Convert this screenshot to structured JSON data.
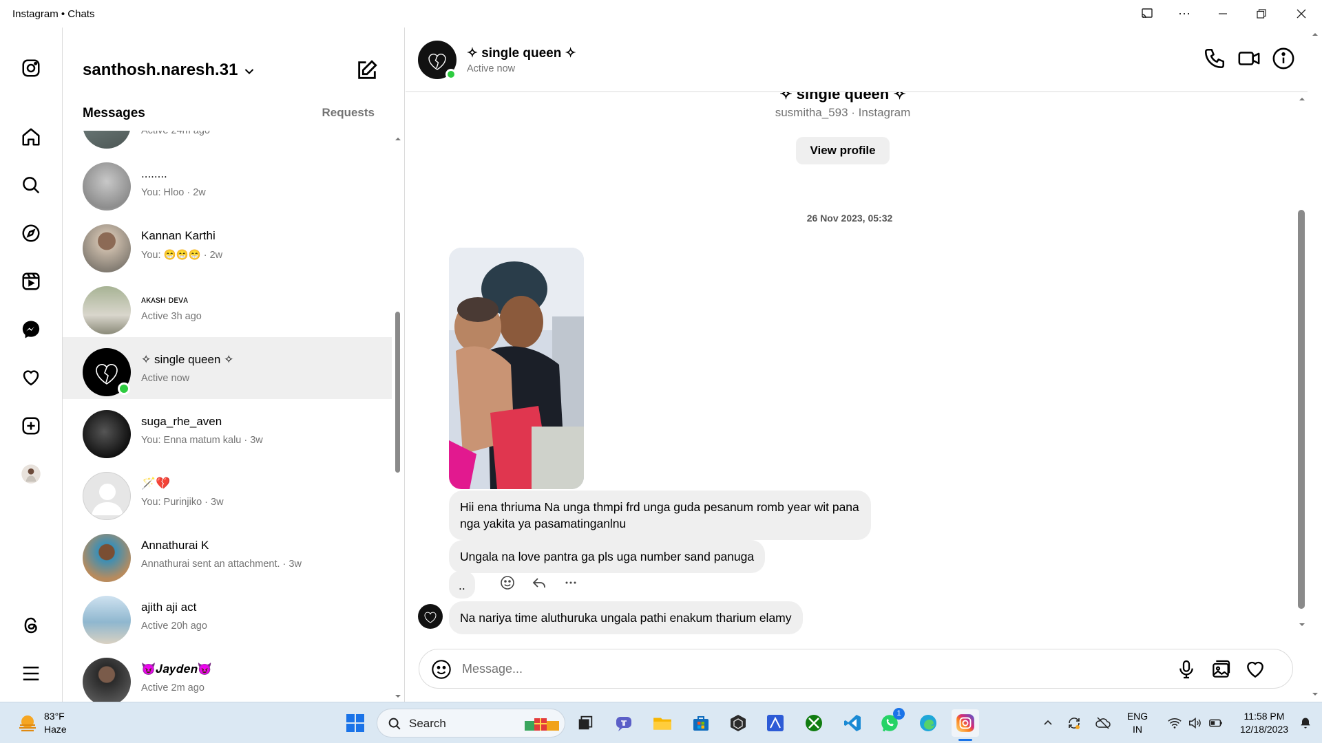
{
  "window": {
    "title": "Instagram • Chats"
  },
  "sidebar": {
    "profile_username": "santhosh.naresh.31"
  },
  "inbox": {
    "messages_label": "Messages",
    "requests_label": "Requests",
    "threads": [
      {
        "name": "",
        "sub": "Active 24m ago"
      },
      {
        "name": "........",
        "sub": "You: Hloo · 2w"
      },
      {
        "name": "Kannan Karthi",
        "sub": "You: 😁😁😁 · 2w"
      },
      {
        "name": "ᴀᴋᴀsʜ ᴅᴇᴠᴀ",
        "sub": "Active 3h ago"
      },
      {
        "name": "✧ single queen ✧",
        "sub": "Active now"
      },
      {
        "name": "suga_rhe_aven",
        "sub": "You: Enna matum kalu · 3w"
      },
      {
        "name": "🪄💔",
        "sub": "You: Purinjiko · 3w"
      },
      {
        "name": "Annathurai K",
        "sub": "Annathurai sent an attachment. · 3w"
      },
      {
        "name": "ajith aji act",
        "sub": "Active 20h ago"
      },
      {
        "name": "😈𝑱𝒂𝒚𝒅𝒆𝒏😈",
        "sub": "Active 2m ago"
      }
    ]
  },
  "chat": {
    "name": "✧ single queen ✧",
    "status": "Active now",
    "profile_name_partial": "✧ single queen ✧",
    "profile_handle": "susmitha_593 · Instagram",
    "view_profile_label": "View profile",
    "date_stamp": "26 Nov 2023, 05:32",
    "messages": [
      {
        "text": "Hii ena thriuma Na unga thmpi frd unga guda pesanum romb year wit pana nga yakita ya pasamatinganlnu"
      },
      {
        "text": "Ungala na love pantra ga pls uga number sand panuga"
      },
      {
        "text": ".."
      },
      {
        "text": "Na nariya time aluthuruka ungala pathi enakum tharium elamy"
      }
    ],
    "composer_placeholder": "Message..."
  },
  "taskbar": {
    "weather_temp": "83°F",
    "weather_desc": "Haze",
    "search_label": "Search",
    "whatsapp_badge": "1",
    "lang_top": "ENG",
    "lang_bottom": "IN",
    "time": "11:58 PM",
    "date": "12/18/2023"
  }
}
